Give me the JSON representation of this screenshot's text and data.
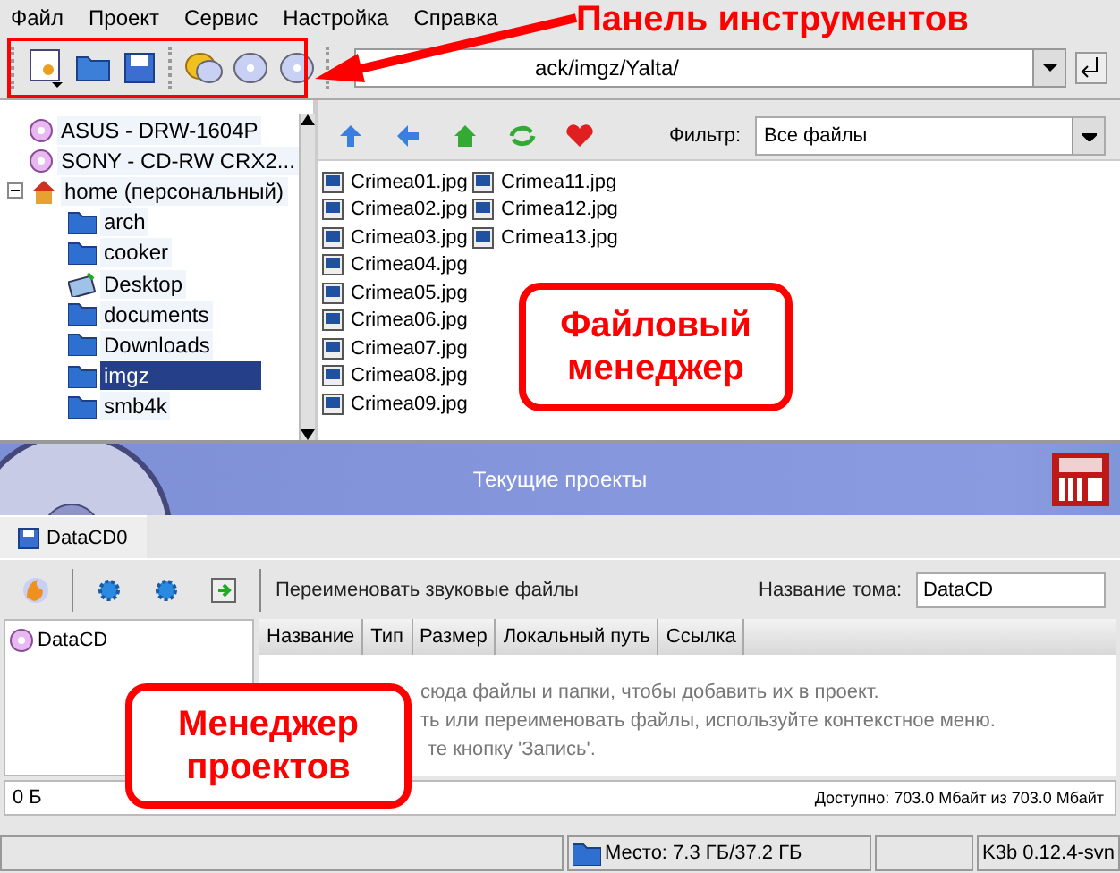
{
  "menu": [
    "Файл",
    "Проект",
    "Сервис",
    "Настройка",
    "Справка"
  ],
  "location": {
    "value": "ack/imgz/Yalta/"
  },
  "tree": [
    {
      "label": "ASUS - DRW-1604P",
      "kind": "drive",
      "selected": false
    },
    {
      "label": "SONY - CD-RW  CRX2...",
      "kind": "drive",
      "selected": false
    },
    {
      "label": "home (персональный)",
      "kind": "home",
      "selected": false,
      "expanded": true,
      "children": [
        {
          "label": "arch",
          "kind": "folder",
          "selected": false
        },
        {
          "label": "cooker",
          "kind": "folder",
          "selected": false
        },
        {
          "label": "Desktop",
          "kind": "desktop",
          "selected": false
        },
        {
          "label": "documents",
          "kind": "folder",
          "selected": false
        },
        {
          "label": "Downloads",
          "kind": "folder",
          "selected": false
        },
        {
          "label": "imgz",
          "kind": "folder",
          "selected": true
        },
        {
          "label": "smb4k",
          "kind": "folder",
          "selected": false
        }
      ]
    }
  ],
  "filter": {
    "label": "Фильтр:",
    "value": "Все файлы"
  },
  "files": [
    "Crimea01.jpg",
    "Crimea02.jpg",
    "Crimea03.jpg",
    "Crimea04.jpg",
    "Crimea05.jpg",
    "Crimea06.jpg",
    "Crimea07.jpg",
    "Crimea08.jpg",
    "Crimea09.jpg",
    "Crimea11.jpg",
    "Crimea12.jpg",
    "Crimea13.jpg"
  ],
  "projects_header": {
    "title": "Текущие проекты"
  },
  "project_tab": {
    "label": "DataCD0"
  },
  "project_toolbar": {
    "rename_label": "Переименовать звуковые файлы",
    "volume_label": "Название тома:",
    "volume_value": "DataCD"
  },
  "project_tree": [
    {
      "label": "DataCD"
    }
  ],
  "table": {
    "columns": [
      "Название",
      "Тип",
      "Размер",
      "Локальный путь",
      "Ссылка"
    ],
    "hint": [
      "сюда файлы и папки, чтобы добавить их в проект.",
      "ть или переименовать файлы, используйте контекстное меню.",
      "те кнопку 'Запись'."
    ]
  },
  "capacity": {
    "used": "0 Б",
    "available": "Доступно: 703.0 Мбайт из 703.0 Мбайт"
  },
  "status_bar": {
    "space": "Место: 7.3 ГБ/37.2 ГБ",
    "version": "K3b 0.12.4-svn"
  },
  "annotations": [
    {
      "text": "Панель инструментов",
      "kind": "arrow"
    },
    {
      "text": "Файловый менеджер",
      "kind": "box"
    },
    {
      "text": "Менеджер проектов",
      "kind": "box"
    }
  ]
}
